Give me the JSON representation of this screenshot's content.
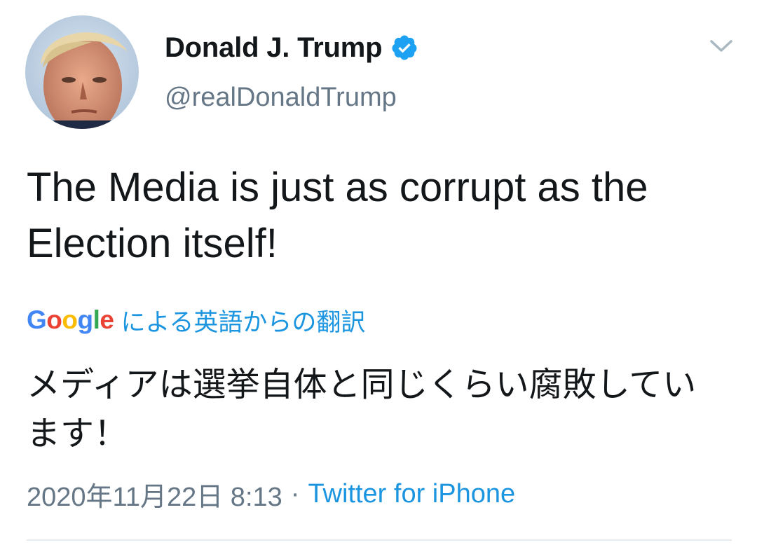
{
  "user": {
    "display_name": "Donald J. Trump",
    "handle": "@realDonaldTrump",
    "verified_icon": "verified-badge-icon",
    "avatar_icon": "profile-avatar"
  },
  "tweet": {
    "text": "The Media is just as corrupt as the Election itself!",
    "more_icon": "chevron-down-icon"
  },
  "translation": {
    "provider_letters": [
      "G",
      "o",
      "o",
      "g",
      "l",
      "e"
    ],
    "provider_colors": [
      "#4285f4",
      "#ea4335",
      "#fbbc05",
      "#4285f4",
      "#34a853",
      "#ea4335"
    ],
    "label": "による英語からの翻訳",
    "text": "メディアは選挙自体と同じくらい腐敗しています！"
  },
  "meta": {
    "timestamp": "2020年11月22日 8:13",
    "separator": "·",
    "source": "Twitter for iPhone"
  },
  "colors": {
    "link": "#1b95e0",
    "secondary_text": "#657786",
    "primary_text": "#14171a",
    "verified": "#1da1f2"
  }
}
